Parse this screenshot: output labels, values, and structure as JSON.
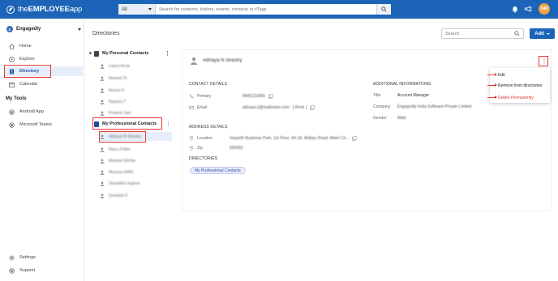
{
  "app": {
    "logo_prefix": "the",
    "logo_main": "EMPLOYEE",
    "logo_suffix": "app"
  },
  "topbar": {
    "scope_value": "All",
    "search_placeholder": "Search for contents, folders, events, contacts or #Tags",
    "avatar_initials": "NM",
    "avatar_color": "#f0a14a",
    "icons": [
      "bell-icon",
      "megaphone-icon"
    ]
  },
  "sidebar": {
    "org_badge": "E",
    "org_name": "Engagedly",
    "items": [
      {
        "label": "Home",
        "icon": "home-icon"
      },
      {
        "label": "Explore",
        "icon": "compass-icon"
      },
      {
        "label": "Directory",
        "icon": "directory-icon",
        "active": true
      },
      {
        "label": "Calendar",
        "icon": "calendar-icon"
      }
    ],
    "tools_heading": "My Tools",
    "tools": [
      {
        "label": "Android App",
        "icon": "android-icon"
      },
      {
        "label": "Microsoft Teams",
        "icon": "teams-icon"
      }
    ],
    "bottom": [
      {
        "label": "Settings",
        "icon": "gear-icon"
      },
      {
        "label": "Support",
        "icon": "support-icon"
      }
    ]
  },
  "main": {
    "title": "Directories",
    "search_placeholder": "Search",
    "add_label": "Add"
  },
  "tree": {
    "personal": {
      "label": "My Personal Contacts",
      "items": [
        "Laxmi Arvar",
        "Naveen N",
        "Navya H",
        "Nayana T",
        "Prateek Jain"
      ]
    },
    "professional": {
      "label": "My Professional Contacts",
      "items": [
        "Abhaya N Shastry",
        "Harry Potter",
        "Mahesh Mehta",
        "Mounya Adith",
        "Shraddha Kapoor",
        "Sreelata K"
      ]
    }
  },
  "contact": {
    "name": "Abhaya N Shastry",
    "contact_details_heading": "CONTACT DETAILS",
    "primary_label": "Primary",
    "primary_value": "9845123456",
    "email_label": "Email",
    "email_value": "abhaya.s@mailinator.com",
    "email_tag": "( Work )",
    "address_heading": "ADDRESS DETAILS",
    "location_label": "Location",
    "location_value": "Vasanth Business Park, 1st Floor, 44-1A, Bellary Road, Mekri Cir...",
    "zip_label": "Zip",
    "zip_value": "560092",
    "directories_heading": "DIRECTORIES",
    "directory_chip": "My Professional Contacts",
    "additional_heading": "ADDITIONAL INFORMATIONS",
    "title_label": "Title",
    "title_value": "Account Manager",
    "company_label": "Company",
    "company_value": "Engagedly India Software Private Limited",
    "gender_label": "Gender",
    "gender_value": "Male"
  },
  "menu": {
    "edit": "Edit",
    "remove": "Remove from directories",
    "delete": "Delete Permanently"
  },
  "colors": {
    "brand": "#1b64b8",
    "highlight": "#e53935",
    "active_bg": "#e6eefb"
  }
}
